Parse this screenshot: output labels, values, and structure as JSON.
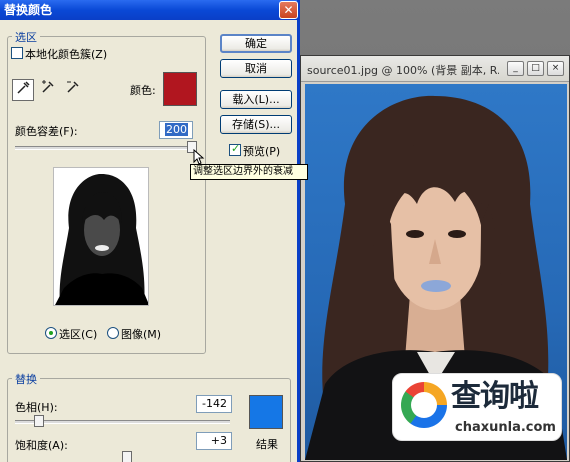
{
  "dialog": {
    "title": "替换颜色",
    "close_label": "✕",
    "selection_group": {
      "label": "选区",
      "localized_clusters_label": "本地化颜色簇(Z)",
      "localized_clusters_checked": false,
      "color_label": "颜色:",
      "color_value": "#b1161f",
      "fuzziness_label": "颜色容差(F):",
      "fuzziness_value": "200",
      "fuzziness_fraction": 1.0,
      "radio_selection_label": "选区(C)",
      "radio_image_label": "图像(M)",
      "selected_view": "selection"
    },
    "tooltip": "调整选区边界外的衰减",
    "buttons": {
      "ok": "确定",
      "cancel": "取消",
      "load": "载入(L)...",
      "save": "存储(S)...",
      "preview_label": "预览(P)",
      "preview_checked": true
    },
    "replacement_group": {
      "label": "替换",
      "hue_label": "色相(H):",
      "hue_value": "-142",
      "saturation_label": "饱和度(A):",
      "saturation_value": "+3",
      "result_label": "结果",
      "result_color": "#1577e6"
    }
  },
  "document": {
    "title": "source01.jpg @ 100% (背景 副本, R...",
    "minimize_label": "_",
    "maximize_label": "□",
    "close_label": "×"
  },
  "watermark": {
    "cn": "查询啦",
    "en": "chaxunla.com"
  },
  "icons": [
    "eyedropper-icon",
    "eyedropper-plus-icon",
    "eyedropper-minus-icon",
    "cursor-arrow-icon"
  ]
}
